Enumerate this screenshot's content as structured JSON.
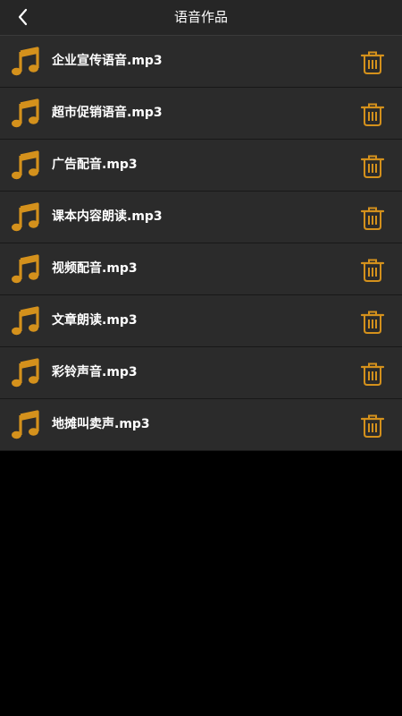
{
  "header": {
    "title": "语音作品",
    "back_icon": "chevron-left-icon"
  },
  "colors": {
    "accent": "#d4911c",
    "header_bg": "#262626",
    "row_bg": "#2b2b2b",
    "page_bg": "#000000"
  },
  "list": {
    "item_icon": "music-note-icon",
    "delete_icon": "trash-icon",
    "items": [
      {
        "label": "企业宣传语音.mp3"
      },
      {
        "label": "超市促销语音.mp3"
      },
      {
        "label": "广告配音.mp3"
      },
      {
        "label": "课本内容朗读.mp3"
      },
      {
        "label": "视频配音.mp3"
      },
      {
        "label": "文章朗读.mp3"
      },
      {
        "label": "彩铃声音.mp3"
      },
      {
        "label": "地摊叫卖声.mp3"
      }
    ]
  }
}
